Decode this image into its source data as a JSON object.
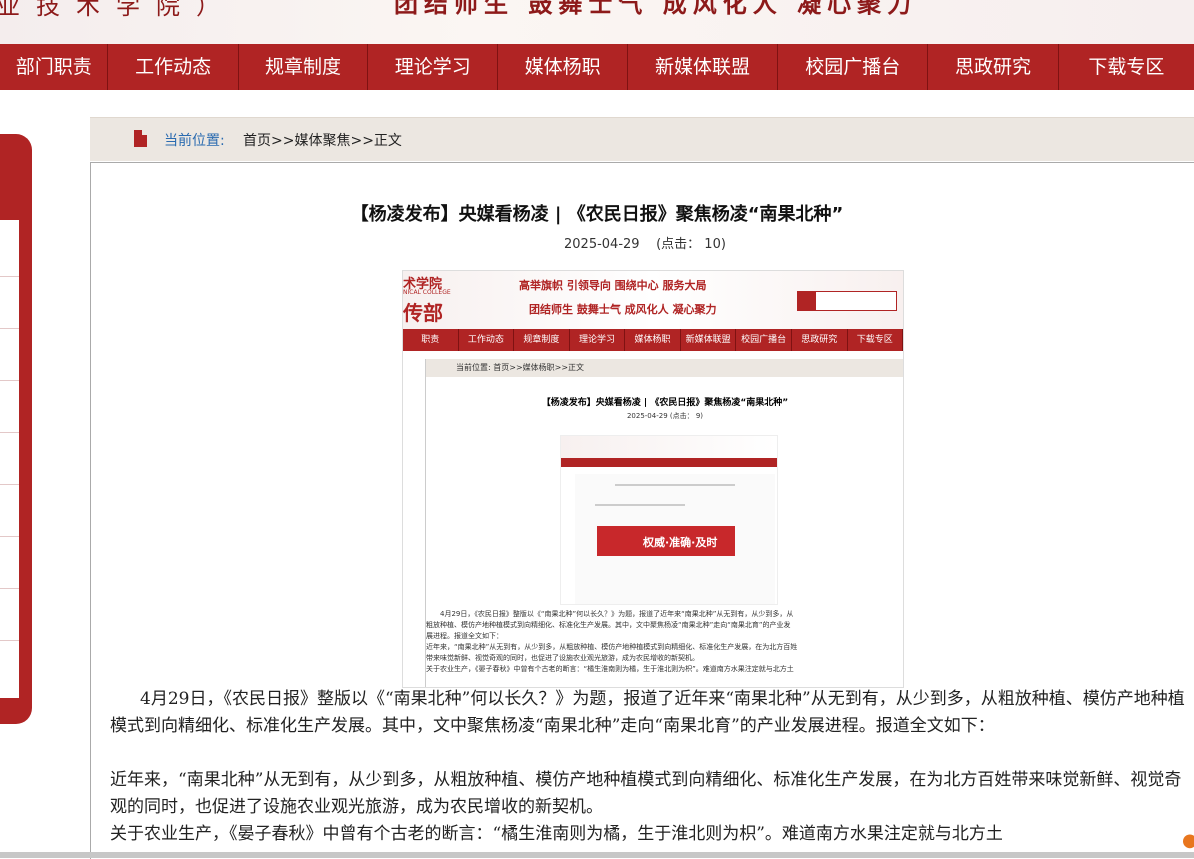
{
  "banner": {
    "left_text": "业技术学院）",
    "right_text": "团结师生 鼓舞士气 成风化人 凝心聚力"
  },
  "nav": {
    "items": [
      "部门职责",
      "工作动态",
      "规章制度",
      "理论学习",
      "媒体杨职",
      "新媒体联盟",
      "校园广播台",
      "思政研究",
      "下载专区"
    ]
  },
  "breadcrumb": {
    "label": "当前位置:",
    "path": "首页>>媒体聚焦>>正文"
  },
  "article": {
    "title": "【杨凌发布】央媒看杨凌 | 《农民日报》聚焦杨凌“南果北种”",
    "date": "2025-04-29",
    "clicks": "(点击： 10)",
    "paragraphs": [
      "4月29日，《农民日报》整版以《“南果北种”何以长久？》为题，报道了近年来“南果北种”从无到有，从少到多，从粗放种植、模仿产地种植模式到向精细化、标准化生产发展。其中，文中聚焦杨凌“南果北种”走向“南果北育”的产业发展进程。报道全文如下：",
      "近年来，“南果北种”从无到有，从少到多，从粗放种植、模仿产地种植模式到向精细化、标准化生产发展，在为北方百姓带来味觉新鲜、视觉奇观的同时，也促进了设施农业观光旅游，成为农民增收的新契机。",
      "关于农业生产，《晏子春秋》中曾有个古老的断言：“橘生淮南则为橘，生于淮北则为枳”。难道南方水果注定就与北方土"
    ]
  },
  "embedded": {
    "header_college": "术学院",
    "header_small": "NICAL COLLEGE",
    "header_dept": "传部",
    "slogan1": "高举旗帜 引领导向 围绕中心 服务大局",
    "slogan2": "团结师生 鼓舞士气 成风化人 凝心聚力",
    "nav": [
      "职责",
      "工作动态",
      "规章制度",
      "理论学习",
      "媒体杨职",
      "新媒体联盟",
      "校园广播台",
      "思政研究",
      "下载专区"
    ],
    "crumb": "当前位置: 首页>>媒体杨职>>正文",
    "title": "【杨凌发布】央媒看杨凌 | 《农民日报》聚焦杨凌“南果北种”",
    "meta": "2025-04-29    (点击： 9)",
    "mini_banner": "权威·准确·及时",
    "text1": "4月29日，《农民日报》整版以《“南果北种”何以长久？》为题，报道了近年来“南果北种”从无到有，从少到多，从",
    "text2": "粗放种植、模仿产地种植模式到向精细化、标准化生产发展。其中，文中聚焦杨凌“南果北种”走向“南果北育”的产业发",
    "text3": "展进程。报道全文如下：",
    "text4": "近年来，“南果北种”从无到有，从少到多，从粗放种植、模仿产地种植模式到向精细化、标准化生产发展，在为北方百姓",
    "text5": "带来味觉新鲜、视觉奇观的同时，也促进了设施农业观光旅游，成为农民增收的新契机。",
    "text6": "关于农业生产，《晏子春秋》中曾有个古老的断言：“橘生淮南则为橘，生于淮北则为枳”。难道南方水果注定就与北方土"
  },
  "colors": {
    "brand_red": "#b02424",
    "link_blue": "#2a6bb0",
    "crumb_bg": "#ece7e1"
  }
}
